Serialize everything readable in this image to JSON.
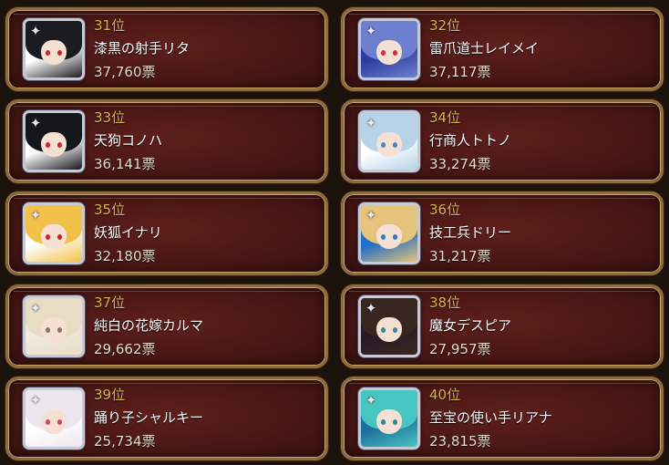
{
  "ranking": [
    {
      "rank": "31位",
      "name": "漆黒の射手リタ",
      "votes": "37,760票",
      "portrait": {
        "bg": "#ffffff",
        "hair": "#1b1b22",
        "eye": "#c02a2a"
      }
    },
    {
      "rank": "32位",
      "name": "雷爪道士レイメイ",
      "votes": "37,117票",
      "portrait": {
        "bg": "#2c3fa0",
        "hair": "#6d7fcf",
        "eye": "#d2303a"
      }
    },
    {
      "rank": "33位",
      "name": "天狗コノハ",
      "votes": "36,141票",
      "portrait": {
        "bg": "#ffffff",
        "hair": "#15151c",
        "eye": "#c8262c"
      }
    },
    {
      "rank": "34位",
      "name": "行商人トトノ",
      "votes": "33,274票",
      "portrait": {
        "bg": "#ffffff",
        "hair": "#b7d3e8",
        "eye": "#4a86c8"
      }
    },
    {
      "rank": "35位",
      "name": "妖狐イナリ",
      "votes": "32,180票",
      "portrait": {
        "bg": "#ffffff",
        "hair": "#f2c14a",
        "eye": "#c8262c"
      }
    },
    {
      "rank": "36位",
      "name": "技工兵ドリー",
      "votes": "31,217票",
      "portrait": {
        "bg": "#1f6ec8",
        "hair": "#e6c37a",
        "eye": "#2f7fc0"
      }
    },
    {
      "rank": "37位",
      "name": "純白の花嫁カルマ",
      "votes": "29,662票",
      "portrait": {
        "bg": "#eeeadf",
        "hair": "#e9dcc4",
        "eye": "#8a7a64"
      }
    },
    {
      "rank": "38位",
      "name": "魔女デスピア",
      "votes": "27,957票",
      "portrait": {
        "bg": "#2a1a26",
        "hair": "#3a2620",
        "eye": "#3a8a9a"
      }
    },
    {
      "rank": "39位",
      "name": "踊り子シャルキー",
      "votes": "25,734票",
      "portrait": {
        "bg": "#ffffff",
        "hair": "#ece7ef",
        "eye": "#c84a6a"
      }
    },
    {
      "rank": "40位",
      "name": "至宝の使い手リアナ",
      "votes": "23,815票",
      "portrait": {
        "bg": "#1f6e9c",
        "hair": "#46c6c0",
        "eye": "#2a8a9a"
      }
    }
  ]
}
